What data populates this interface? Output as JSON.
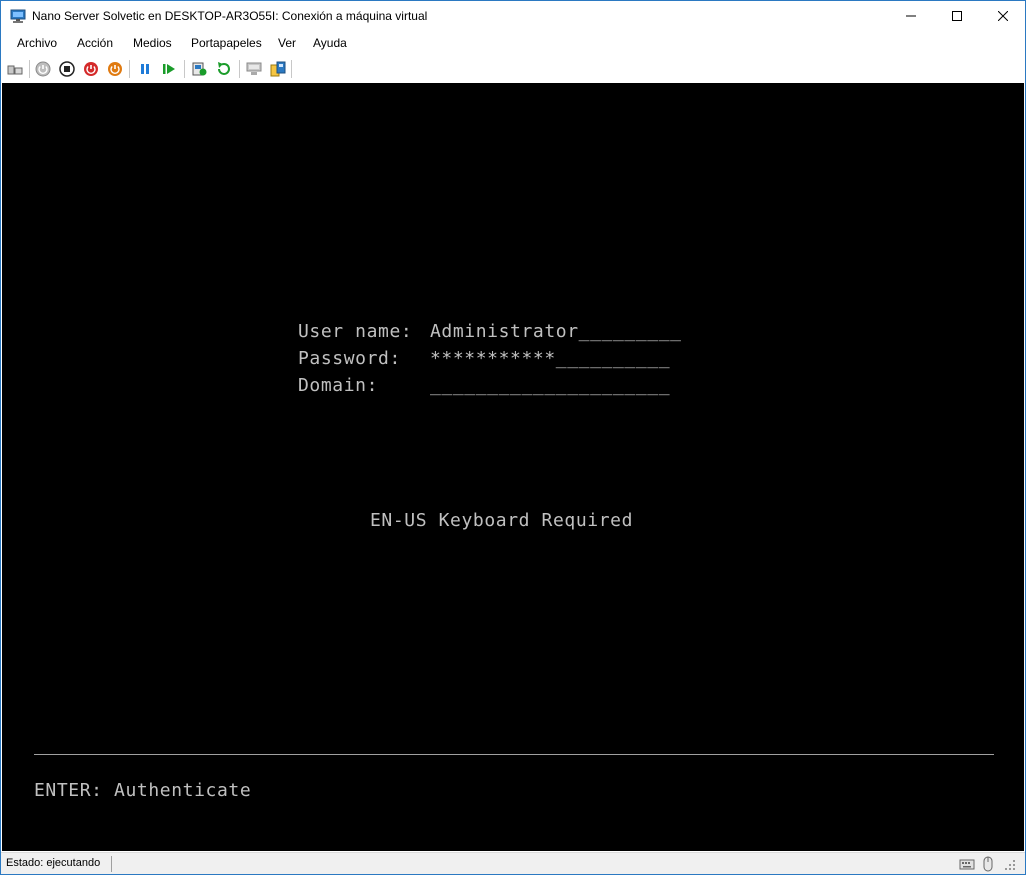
{
  "window": {
    "title": "Nano Server Solvetic en DESKTOP-AR3O55I: Conexión a máquina virtual"
  },
  "menu": {
    "items": [
      "Archivo",
      "Acción",
      "Medios",
      "Portapapeles",
      "Ver",
      "Ayuda"
    ]
  },
  "toolbar": {
    "buttons": [
      "ctrl-alt-del-icon",
      "start-icon",
      "turn-off-icon",
      "shutdown-icon",
      "power-icon",
      "pause-icon",
      "resume-icon",
      "checkpoint-icon",
      "revert-icon",
      "enhanced-session-icon",
      "share-icon"
    ]
  },
  "console": {
    "username_label": "User name:",
    "username_value": "Administrator_________",
    "password_label": "Password:",
    "password_value": "***********__________",
    "domain_label": "Domain:",
    "domain_value": "_____________________",
    "keyboard_notice": "EN-US Keyboard Required",
    "footer_action": "ENTER: Authenticate"
  },
  "status": {
    "text": "Estado: ejecutando"
  },
  "colors": {
    "console_bg": "#000000",
    "console_text": "#c0c0c0",
    "pause_blue": "#1f7bd8",
    "resume_green": "#1a9c2a",
    "stop_red": "#d42a2a",
    "power_orange": "#e07a10"
  }
}
